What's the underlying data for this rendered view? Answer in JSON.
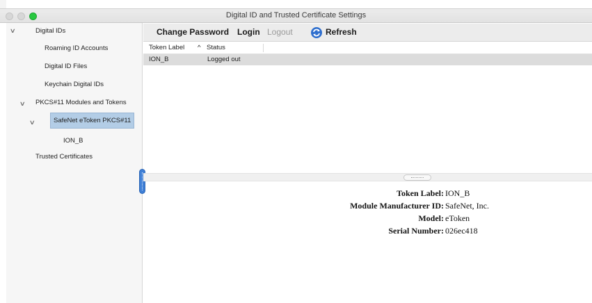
{
  "window": {
    "title": "Digital ID and Trusted Certificate Settings"
  },
  "sidebar": {
    "items": [
      {
        "label": "Digital IDs",
        "expanded": true
      },
      {
        "label": "Roaming ID Accounts"
      },
      {
        "label": "Digital ID Files"
      },
      {
        "label": "Keychain Digital IDs"
      },
      {
        "label": "PKCS#11 Modules and Tokens",
        "expanded": true
      },
      {
        "label": "SafeNet eToken PKCS#11",
        "expanded": true,
        "selected": true
      },
      {
        "label": "ION_B"
      },
      {
        "label": "Trusted Certificates"
      }
    ]
  },
  "toolbar": {
    "change_password": "Change Password",
    "login": "Login",
    "logout": "Logout",
    "refresh": "Refresh",
    "refresh_icon": "refresh-icon",
    "accent": "#2f6fce"
  },
  "table": {
    "columns": [
      {
        "label": "Token Label",
        "sort": "^"
      },
      {
        "label": "Status"
      }
    ],
    "rows": [
      {
        "token_label": "ION_B",
        "status": "Logged out"
      }
    ]
  },
  "details": {
    "rows": [
      {
        "key": "Token Label:",
        "value": "ION_B"
      },
      {
        "key": "Module Manufacturer ID:",
        "value": "SafeNet, Inc."
      },
      {
        "key": "Model:",
        "value": "eToken"
      },
      {
        "key": "Serial Number:",
        "value": "026ec418"
      }
    ]
  },
  "colors": {
    "selection": "#b3cde6",
    "row_highlight": "#dcdcdc",
    "splitter": "#3f7fd6",
    "traffic_green": "#28c840"
  }
}
